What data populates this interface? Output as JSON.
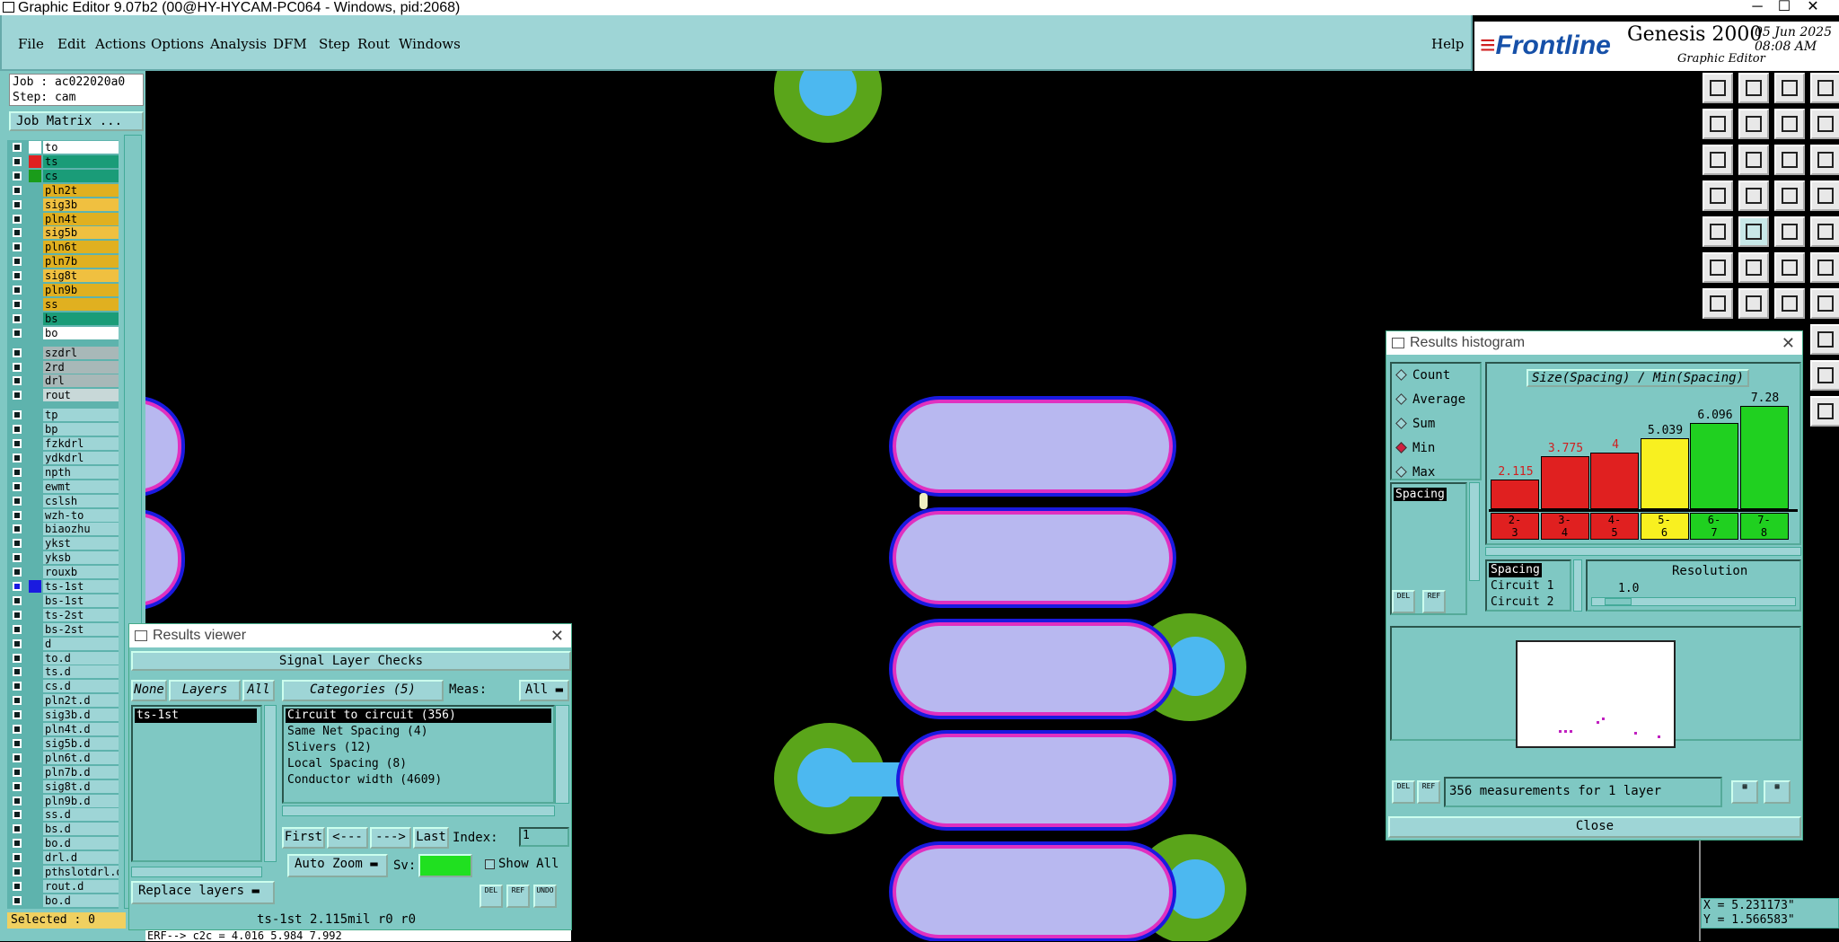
{
  "window": {
    "title": "Graphic Editor 9.07b2 (00@HY-HYCAM-PC064 - Windows, pid:2068)"
  },
  "menu": [
    "File",
    "Edit",
    "Actions",
    "Options",
    "Analysis",
    "DFM",
    "Step",
    "Rout",
    "Windows"
  ],
  "help": "Help",
  "brand": {
    "frontline_red": "≡",
    "frontline": "Frontline",
    "product": "Genesis 2000",
    "subtitle": "Graphic Editor",
    "date": "05 Jun 2025",
    "time": "08:08 AM"
  },
  "job": {
    "job": "Job : ac022020a0",
    "step": "Step: cam",
    "matrix_button": "Job Matrix ..."
  },
  "layers": [
    {
      "name": "to",
      "color": "#ffffff",
      "swatch": "#ffffff"
    },
    {
      "name": "ts",
      "color": "#1a9c78",
      "swatch": "#e02020"
    },
    {
      "name": "cs",
      "color": "#1a9c78",
      "swatch": "#1a9c1a"
    },
    {
      "name": "pln2t",
      "color": "#e0b020",
      "swatch": ""
    },
    {
      "name": "sig3b",
      "color": "#f0c040",
      "swatch": ""
    },
    {
      "name": "pln4t",
      "color": "#e0b020",
      "swatch": ""
    },
    {
      "name": "sig5b",
      "color": "#f0c040",
      "swatch": ""
    },
    {
      "name": "pln6t",
      "color": "#e0b020",
      "swatch": ""
    },
    {
      "name": "pln7b",
      "color": "#e0b020",
      "swatch": ""
    },
    {
      "name": "sig8t",
      "color": "#f0c040",
      "swatch": ""
    },
    {
      "name": "pln9b",
      "color": "#e0b020",
      "swatch": ""
    },
    {
      "name": "ss",
      "color": "#e0b020",
      "swatch": ""
    },
    {
      "name": "bs",
      "color": "#1a9c78",
      "swatch": ""
    },
    {
      "name": "bo",
      "color": "#ffffff",
      "swatch": ""
    },
    {
      "name": "szdrl",
      "color": "#a8b8b8",
      "swatch": ""
    },
    {
      "name": "2rd",
      "color": "#a8b8b8",
      "swatch": ""
    },
    {
      "name": "drl",
      "color": "#a8b8b8",
      "swatch": ""
    },
    {
      "name": "rout",
      "color": "#c8d8d8",
      "swatch": ""
    },
    {
      "name": "tp",
      "color": "#9ed5d6",
      "swatch": ""
    },
    {
      "name": "bp",
      "color": "#9ed5d6",
      "swatch": ""
    },
    {
      "name": "fzkdrl",
      "color": "#9ed5d6",
      "swatch": ""
    },
    {
      "name": "ydkdrl",
      "color": "#9ed5d6",
      "swatch": ""
    },
    {
      "name": "npth",
      "color": "#9ed5d6",
      "swatch": ""
    },
    {
      "name": "ewmt",
      "color": "#9ed5d6",
      "swatch": ""
    },
    {
      "name": "cslsh",
      "color": "#9ed5d6",
      "swatch": ""
    },
    {
      "name": "wzh-to",
      "color": "#9ed5d6",
      "swatch": ""
    },
    {
      "name": "biaozhu",
      "color": "#9ed5d6",
      "swatch": ""
    },
    {
      "name": "ykst",
      "color": "#9ed5d6",
      "swatch": ""
    },
    {
      "name": "yksb",
      "color": "#9ed5d6",
      "swatch": ""
    },
    {
      "name": "rouxb",
      "color": "#9ed5d6",
      "swatch": ""
    },
    {
      "name": "ts-1st",
      "color": "#9ed5d6",
      "swatch": "#1a1ae0"
    },
    {
      "name": "bs-1st",
      "color": "#9ed5d6",
      "swatch": ""
    },
    {
      "name": "ts-2st",
      "color": "#9ed5d6",
      "swatch": ""
    },
    {
      "name": "bs-2st",
      "color": "#9ed5d6",
      "swatch": ""
    },
    {
      "name": "d",
      "color": "#9ed5d6",
      "swatch": ""
    },
    {
      "name": "to.d",
      "color": "#9ed5d6",
      "swatch": ""
    },
    {
      "name": "ts.d",
      "color": "#9ed5d6",
      "swatch": ""
    },
    {
      "name": "cs.d",
      "color": "#9ed5d6",
      "swatch": ""
    },
    {
      "name": "pln2t.d",
      "color": "#9ed5d6",
      "swatch": ""
    },
    {
      "name": "sig3b.d",
      "color": "#9ed5d6",
      "swatch": ""
    },
    {
      "name": "pln4t.d",
      "color": "#9ed5d6",
      "swatch": ""
    },
    {
      "name": "sig5b.d",
      "color": "#9ed5d6",
      "swatch": ""
    },
    {
      "name": "pln6t.d",
      "color": "#9ed5d6",
      "swatch": ""
    },
    {
      "name": "pln7b.d",
      "color": "#9ed5d6",
      "swatch": ""
    },
    {
      "name": "sig8t.d",
      "color": "#9ed5d6",
      "swatch": ""
    },
    {
      "name": "pln9b.d",
      "color": "#9ed5d6",
      "swatch": ""
    },
    {
      "name": "ss.d",
      "color": "#9ed5d6",
      "swatch": ""
    },
    {
      "name": "bs.d",
      "color": "#9ed5d6",
      "swatch": ""
    },
    {
      "name": "bo.d",
      "color": "#9ed5d6",
      "swatch": ""
    },
    {
      "name": "drl.d",
      "color": "#9ed5d6",
      "swatch": ""
    },
    {
      "name": "pthslotdrl.d",
      "color": "#9ed5d6",
      "swatch": ""
    },
    {
      "name": "rout.d",
      "color": "#9ed5d6",
      "swatch": ""
    },
    {
      "name": "bo.d",
      "color": "#9ed5d6",
      "swatch": ""
    }
  ],
  "selected": "Selected : 0",
  "status_line": "ERF--> c2c = 4.016 5.984 7.992",
  "results_viewer": {
    "title": "Results viewer",
    "header": "Signal Layer Checks",
    "none": "None",
    "layers": "Layers",
    "all": "All",
    "layer_list": [
      "ts-1st"
    ],
    "categories_label": "Categories (5)",
    "meas_label": "Meas:",
    "meas_value": "All",
    "categories": [
      "Circuit to circuit (356)",
      "Same Net Spacing (4)",
      "Slivers (12)",
      "Local Spacing (8)",
      "Conductor width (4609)"
    ],
    "first": "First",
    "prev": "<---",
    "next": "--->",
    "last": "Last",
    "index_label": "Index:",
    "index_value": "1",
    "auto_zoom": "Auto Zoom",
    "sv_label": "Sv:",
    "show_all": "Show All",
    "replace_layers": "Replace layers",
    "del": "DEL",
    "ref": "REF",
    "undo": "UNDO",
    "status": "ts-1st 2.115mil  r0  r0"
  },
  "histogram": {
    "title": "Results histogram",
    "modes": [
      {
        "label": "Count",
        "on": false
      },
      {
        "label": "Average",
        "on": false
      },
      {
        "label": "Sum",
        "on": false
      },
      {
        "label": "Min",
        "on": true
      },
      {
        "label": "Max",
        "on": false
      }
    ],
    "spacing_item": "Spacing",
    "chart_title": "Size(Spacing) / Min(Spacing)",
    "bins": [
      {
        "label_a": "2-",
        "label_b": "3",
        "value": 2.115,
        "value_text": "2.115",
        "color": "#e02020"
      },
      {
        "label_a": "3-",
        "label_b": "4",
        "value": 3.775,
        "value_text": "3.775",
        "color": "#e02020"
      },
      {
        "label_a": "4-",
        "label_b": "5",
        "value": 4,
        "value_text": "4",
        "color": "#e02020"
      },
      {
        "label_a": "5-",
        "label_b": "6",
        "value": 5.039,
        "value_text": "5.039",
        "color": "#f8f020"
      },
      {
        "label_a": "6-",
        "label_b": "7",
        "value": 6.096,
        "value_text": "6.096",
        "color": "#20d020"
      },
      {
        "label_a": "7-",
        "label_b": "8",
        "value": 7.28,
        "value_text": "7.28",
        "color": "#20d020"
      }
    ],
    "attr_list": [
      "Spacing",
      "Circuit 1",
      "Circuit 2"
    ],
    "resolution_label": "Resolution",
    "resolution_value": "1.0",
    "summary": "356 measurements for 1 layer",
    "close": "Close",
    "del": "DEL",
    "ref": "REF"
  },
  "coords": {
    "x": "X = 5.231173\"",
    "y": "Y = 1.566583\""
  }
}
